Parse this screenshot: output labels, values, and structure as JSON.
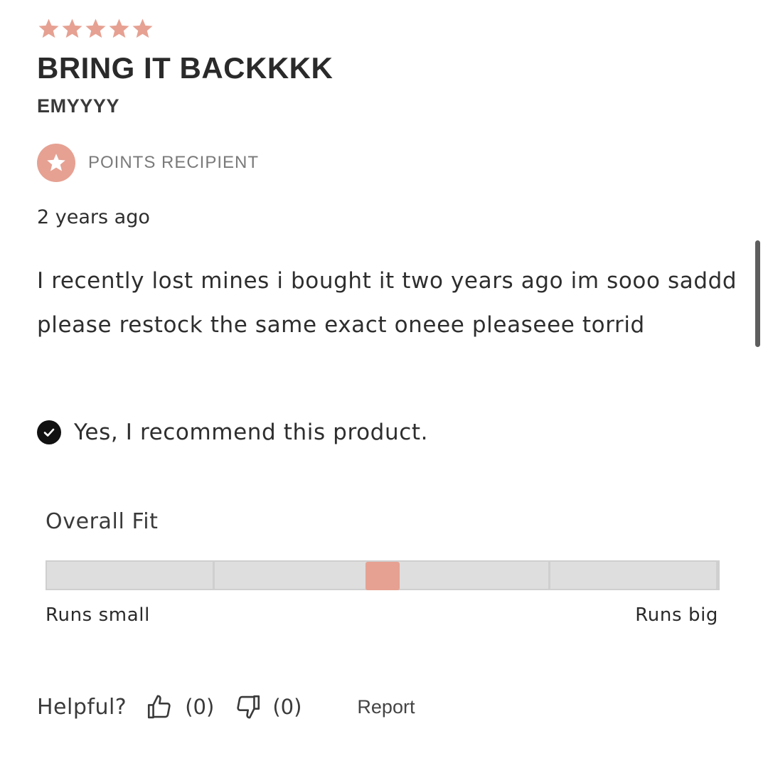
{
  "review": {
    "rating": 5,
    "rating_max": 5,
    "star_color": "#e6a192",
    "title": "BRING IT BACKKKK",
    "author": "EMYYYY",
    "badge": {
      "icon": "star-icon",
      "label": "POINTS RECIPIENT",
      "color": "#e6a192"
    },
    "time_ago": "2 years ago",
    "body": "I recently lost mines i bought it two years ago im sooo saddd please restock the same exact oneee pleaseee torrid",
    "recommend": {
      "icon": "check-circle-icon",
      "label": "Yes, I recommend this product."
    },
    "fit": {
      "title": "Overall Fit",
      "low_label": "Runs small",
      "high_label": "Runs big",
      "value": 0.5,
      "segments": 4,
      "marker_color": "#e6a192"
    },
    "helpful": {
      "label": "Helpful?",
      "up_icon": "thumbs-up-icon",
      "up_count": "(0)",
      "down_icon": "thumbs-down-icon",
      "down_count": "(0)",
      "report_label": "Report"
    }
  }
}
